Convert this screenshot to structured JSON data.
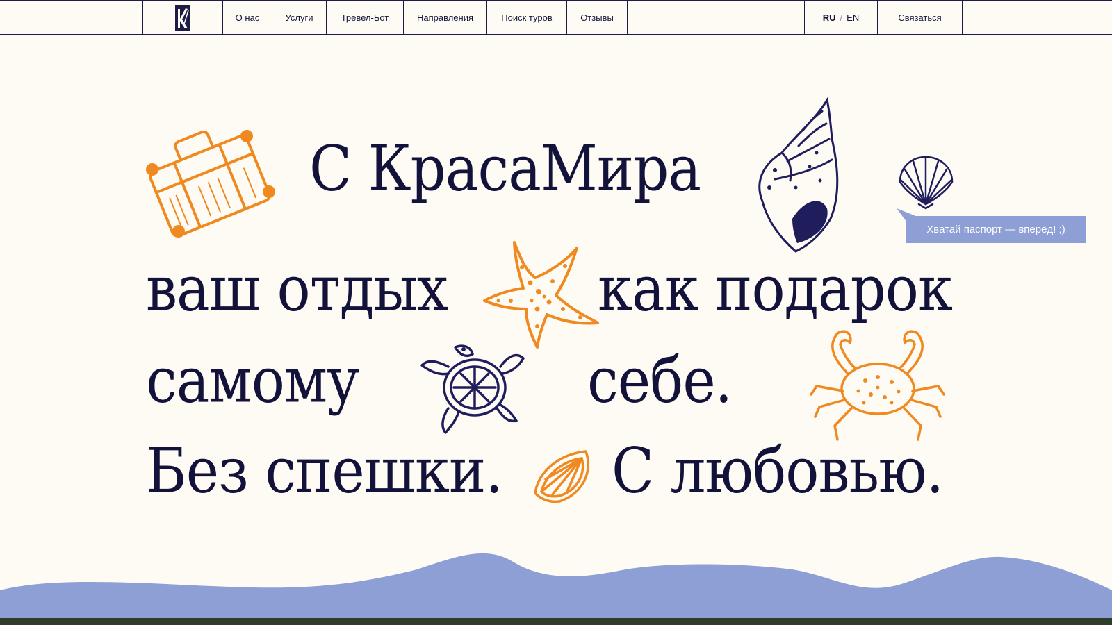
{
  "nav": {
    "items": [
      {
        "label": "О нас"
      },
      {
        "label": "Услуги"
      },
      {
        "label": "Тревел-Бот"
      },
      {
        "label": "Направления"
      },
      {
        "label": "Поиск туров"
      },
      {
        "label": "Отзывы"
      }
    ],
    "lang_ru": "RU",
    "lang_sep": "/",
    "lang_en": "EN",
    "contact_label": "Связаться"
  },
  "hero": {
    "line1": "С КрасаМира",
    "line2a": "ваш отдых",
    "line2b": "как подарок",
    "line3a": "самому",
    "line3b": "себе.",
    "line4a": "Без спешки.",
    "line4b": "С любовью."
  },
  "tooltip": {
    "text": "Хватай паспорт — вперёд! ;)"
  },
  "colors": {
    "background": "#fdfbf4",
    "ink": "#13123a",
    "orange": "#f0891f",
    "wave": "#8e9fd6"
  },
  "icons": [
    "logo-icon",
    "suitcase-icon",
    "conch-shell-icon",
    "scallop-shell-icon",
    "starfish-icon",
    "turtle-icon",
    "crab-icon",
    "orange-slice-icon"
  ]
}
